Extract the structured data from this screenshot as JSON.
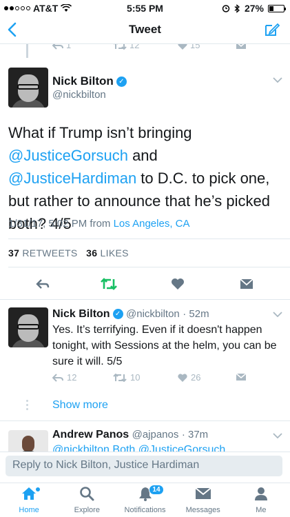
{
  "status_bar": {
    "carrier": "AT&T",
    "time": "5:55 PM",
    "battery": "27%",
    "battery_level": 0.27
  },
  "nav": {
    "title": "Tweet",
    "back_icon": "chevron-left-icon",
    "compose_icon": "compose-icon"
  },
  "previous_tweet": {
    "reply_count": "1",
    "retweet_count": "12",
    "like_count": "15"
  },
  "main_tweet": {
    "name": "Nick Bilton",
    "handle": "@nickbilton",
    "text_1": "What if Trump isn’t bringing ",
    "mention_1": "@JusticeGorsuch",
    "text_2": " and ",
    "mention_2": "@JusticeHardiman",
    "text_3": " to D.C. to pick one, but rather to announce that he’s picked both? 4/5",
    "date": "1/31/17, 5:02 PM from",
    "location": "Los Angeles, CA",
    "retweets_count": "37",
    "retweets_label": "RETWEETS",
    "likes_count": "36",
    "likes_label": "LIKES"
  },
  "reply_1": {
    "name": "Nick Bilton",
    "handle": "@nickbilton",
    "time": "· 52m",
    "text": "Yes. It’s terrifying. Even if it doesn't happen tonight, with Sessions at the helm, you can be sure it will. 5/5",
    "reply_count": "12",
    "retweet_count": "10",
    "like_count": "26"
  },
  "show_more": "Show more",
  "reply_2": {
    "name": "Andrew Panos",
    "handle": "@ajpanos",
    "time": "· 37m",
    "text_partial": "@nickbilton Both @JusticeGorsuch"
  },
  "reply_input": {
    "placeholder": "Reply to Nick Bilton, Justice Hardiman"
  },
  "tabs": [
    {
      "label": "Home",
      "icon": "home-icon"
    },
    {
      "label": "Explore",
      "icon": "search-icon"
    },
    {
      "label": "Notifications",
      "icon": "bell-icon",
      "badge": "14"
    },
    {
      "label": "Messages",
      "icon": "envelope-icon"
    },
    {
      "label": "Me",
      "icon": "person-icon"
    }
  ],
  "colors": {
    "accent": "#1da1f2",
    "retweet_green": "#17bf63",
    "muted": "#657786",
    "icon_gray": "#aab8c2"
  }
}
